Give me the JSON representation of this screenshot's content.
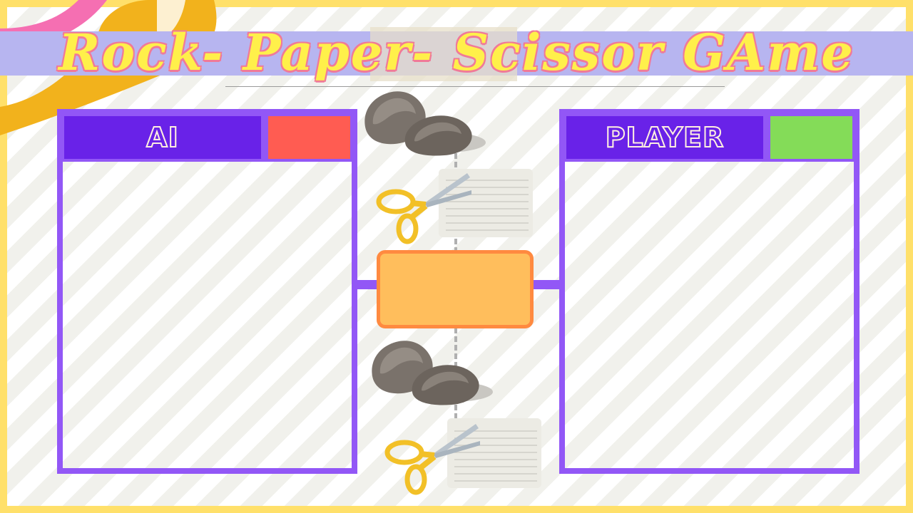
{
  "title": "Rock- Paper- Scissor GAme",
  "ai_panel": {
    "label": "AI",
    "score_color": "#FF5C52"
  },
  "player_panel": {
    "label": "PLAYER",
    "score_color": "#84DC58"
  },
  "icons": [
    "rock-icon",
    "scissors-paper-icon",
    "rock-icon",
    "scissors-paper-icon"
  ],
  "colors": {
    "frame": "#FFE06A",
    "panel_border": "#9257F6",
    "label_bg": "#6922E8",
    "result_fill": "#FFBE5C",
    "result_border": "#FF8A40",
    "title_band": "#B7B5F0",
    "title_text": "#FFF04A"
  }
}
